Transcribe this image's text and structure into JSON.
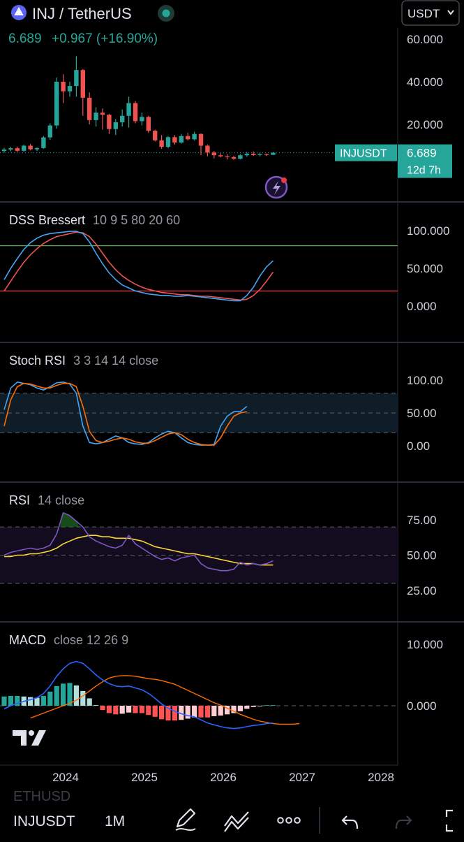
{
  "header": {
    "pair_title": "INJ / TetherUS",
    "price": "6.689",
    "change": "+0.967 (+16.90%)",
    "currency": "USDT"
  },
  "price_pane": {
    "axis_labels": [
      "60.000",
      "40.000",
      "20.000"
    ],
    "axis_values": [
      60,
      40,
      20
    ],
    "tag_symbol": "INJUSDT",
    "tag_price": "6.689",
    "tag_countdown": "12d 7h",
    "last_price": 6.689
  },
  "panes": {
    "dss": {
      "name": "DSS Bressert",
      "params": "10 9 5 80 20 60",
      "axis_labels": [
        "100.000",
        "50.000",
        "0.000"
      ]
    },
    "stoch": {
      "name": "Stoch RSI",
      "params": "3 3 14 14 close",
      "axis_labels": [
        "100.00",
        "50.00",
        "0.00"
      ]
    },
    "rsi": {
      "name": "RSI",
      "params": "14 close",
      "axis_labels": [
        "75.00",
        "50.00",
        "25.00"
      ]
    },
    "macd": {
      "name": "MACD",
      "params": "close 12 26 9",
      "axis_labels": [
        "10.000",
        "0.000"
      ]
    }
  },
  "time_axis": [
    "2024",
    "2025",
    "2026",
    "2027",
    "2028"
  ],
  "bottom_bar": {
    "watermark": "ETHUSD",
    "symbol": "INJUSDT",
    "interval": "1M"
  },
  "colors": {
    "background": "#000000",
    "up": "#26a69a",
    "down": "#ef5350",
    "blue": "#2962ff",
    "orange": "#ff6d00",
    "green_level": "#4caf50",
    "red_level": "#f23645",
    "rsi_line": "#7e57c2",
    "rsi_ma": "#fdd835"
  },
  "icons": [
    "brand-logo-icon",
    "market-open-icon",
    "chevron-down-icon",
    "lightning-icon",
    "tradingview-logo-icon",
    "pen-icon",
    "indicators-icon",
    "more-icon",
    "undo-icon",
    "redo-icon",
    "fullscreen-icon"
  ],
  "chart_data": {
    "type": "candlestick",
    "interval": "1M",
    "months": [
      "2023-04",
      "2023-05",
      "2023-06",
      "2023-07",
      "2023-08",
      "2023-09",
      "2023-10",
      "2023-11",
      "2023-12",
      "2024-01",
      "2024-02",
      "2024-03",
      "2024-04",
      "2024-05",
      "2024-06",
      "2024-07",
      "2024-08",
      "2024-09",
      "2024-10",
      "2024-11",
      "2024-12",
      "2025-01",
      "2025-02",
      "2025-03",
      "2025-04",
      "2025-05",
      "2025-06",
      "2025-07",
      "2025-08",
      "2025-09",
      "2025-10",
      "2025-11",
      "2025-12",
      "2026-01",
      "2026-02",
      "2026-03",
      "2026-04",
      "2026-05",
      "2026-06",
      "2026-07",
      "2026-08",
      "2026-09"
    ],
    "ohlc": [
      [
        7.5,
        9.0,
        6.8,
        8.2
      ],
      [
        8.2,
        9.5,
        7.4,
        8.8
      ],
      [
        8.8,
        9.6,
        7.0,
        7.6
      ],
      [
        7.6,
        10.5,
        7.2,
        10.0
      ],
      [
        10.0,
        10.8,
        7.8,
        8.3
      ],
      [
        8.3,
        9.2,
        7.5,
        8.9
      ],
      [
        8.9,
        14.5,
        8.5,
        13.9
      ],
      [
        13.9,
        20.5,
        12.8,
        19.5
      ],
      [
        19.5,
        42.0,
        18.0,
        40.0
      ],
      [
        40.0,
        43.5,
        30.0,
        35.5
      ],
      [
        35.5,
        40.0,
        33.0,
        38.0
      ],
      [
        38.0,
        52.0,
        33.0,
        45.5
      ],
      [
        45.5,
        46.0,
        24.0,
        32.5
      ],
      [
        32.5,
        35.0,
        20.0,
        22.0
      ],
      [
        22.0,
        28.0,
        19.0,
        25.5
      ],
      [
        25.5,
        27.5,
        17.5,
        24.5
      ],
      [
        24.5,
        25.0,
        15.5,
        17.8
      ],
      [
        17.8,
        22.5,
        15.0,
        21.0
      ],
      [
        21.0,
        27.0,
        19.0,
        24.0
      ],
      [
        24.0,
        33.0,
        18.5,
        30.0
      ],
      [
        30.0,
        31.0,
        20.5,
        21.5
      ],
      [
        21.5,
        25.5,
        19.5,
        23.5
      ],
      [
        23.5,
        24.0,
        16.0,
        17.0
      ],
      [
        17.0,
        17.5,
        12.0,
        12.5
      ],
      [
        12.5,
        15.0,
        8.5,
        9.5
      ],
      [
        9.5,
        14.5,
        8.8,
        14.0
      ],
      [
        14.0,
        15.0,
        10.5,
        11.5
      ],
      [
        11.5,
        15.5,
        11.0,
        14.5
      ],
      [
        14.5,
        16.0,
        12.5,
        13.0
      ],
      [
        13.0,
        16.5,
        12.5,
        15.5
      ],
      [
        15.5,
        15.8,
        5.5,
        10.0
      ],
      [
        10.0,
        10.5,
        5.0,
        6.8
      ],
      [
        6.8,
        7.5,
        4.0,
        5.5
      ],
      [
        5.5,
        6.5,
        4.5,
        5.0
      ],
      [
        5.0,
        6.0,
        3.5,
        4.6
      ],
      [
        4.6,
        5.2,
        3.4,
        3.9
      ],
      [
        3.9,
        6.0,
        3.6,
        5.5
      ],
      [
        5.5,
        7.0,
        4.8,
        6.2
      ],
      [
        6.2,
        7.3,
        5.2,
        5.6
      ],
      [
        5.6,
        6.8,
        5.0,
        6.0
      ],
      [
        6.0,
        6.4,
        5.2,
        5.722
      ],
      [
        5.722,
        7.0,
        5.6,
        6.689
      ]
    ],
    "price_axis": {
      "ticks": [
        60,
        40,
        20
      ],
      "last": 6.689
    },
    "dss": {
      "levels": [
        80,
        20
      ],
      "k": [
        35,
        50,
        63,
        75,
        84,
        90,
        94,
        96,
        97,
        98,
        99,
        99,
        96,
        85,
        70,
        56,
        44,
        35,
        28,
        24,
        20,
        18,
        16,
        15,
        14,
        14,
        13,
        13,
        14,
        13,
        12,
        11,
        10,
        9,
        8,
        7,
        7,
        14,
        25,
        40,
        52,
        60
      ],
      "d": [
        20,
        33,
        46,
        58,
        68,
        76,
        83,
        88,
        92,
        94,
        96,
        98,
        97,
        92,
        82,
        70,
        58,
        48,
        40,
        34,
        29,
        25,
        22,
        20,
        18,
        17,
        16,
        15,
        15,
        14,
        13,
        13,
        12,
        11,
        10,
        9,
        8,
        9,
        14,
        22,
        33,
        45
      ]
    },
    "stoch_rsi": {
      "levels": [
        80,
        50,
        20
      ],
      "k": [
        55,
        88,
        97,
        95,
        93,
        88,
        85,
        90,
        96,
        97,
        94,
        80,
        30,
        5,
        3,
        5,
        10,
        15,
        12,
        5,
        3,
        2,
        5,
        12,
        18,
        22,
        20,
        12,
        5,
        2,
        1,
        1,
        2,
        30,
        45,
        52,
        52,
        60
      ],
      "d": [
        30,
        70,
        90,
        95,
        94,
        91,
        88,
        88,
        92,
        95,
        95,
        90,
        60,
        22,
        8,
        5,
        7,
        10,
        12,
        10,
        6,
        4,
        4,
        8,
        13,
        18,
        20,
        17,
        10,
        5,
        2,
        1,
        1,
        12,
        30,
        45,
        50,
        52
      ]
    },
    "rsi": {
      "levels": [
        70,
        50,
        30
      ],
      "value": [
        50,
        52,
        53,
        54,
        55,
        54,
        55,
        57,
        65,
        80,
        78,
        74,
        70,
        63,
        60,
        58,
        56,
        55,
        57,
        64,
        58,
        55,
        52,
        49,
        47,
        48,
        46,
        48,
        49,
        50,
        44,
        41,
        40,
        39,
        39,
        40,
        45,
        43,
        44,
        43,
        44,
        46
      ],
      "ma": [
        49,
        49,
        50,
        50,
        51,
        51,
        52,
        53,
        55,
        58,
        60,
        62,
        63,
        64,
        64,
        63,
        63,
        62,
        62,
        62,
        61,
        60,
        58,
        56,
        55,
        54,
        53,
        52,
        51,
        51,
        50,
        49,
        48,
        47,
        46,
        45,
        44,
        44,
        44,
        43,
        43,
        43
      ]
    },
    "macd": {
      "macd": [
        -0.5,
        0.0,
        0.4,
        0.7,
        1.0,
        1.3,
        2.0,
        3.2,
        4.8,
        6.0,
        6.9,
        7.2,
        6.9,
        6.0,
        5.0,
        4.2,
        3.6,
        3.2,
        3.1,
        3.2,
        2.9,
        2.6,
        2.0,
        1.2,
        0.3,
        -0.4,
        -0.9,
        -1.3,
        -1.6,
        -1.8,
        -2.3,
        -2.8,
        -3.1,
        -3.4,
        -3.6,
        -3.7,
        -3.6,
        -3.4,
        -3.2,
        -3.1,
        -2.9,
        -2.8
      ],
      "signal": [
        -2.0,
        -1.6,
        -1.2,
        -0.8,
        -0.4,
        0.0,
        0.4,
        0.9,
        1.6,
        2.4,
        3.2,
        3.9,
        4.5,
        4.8,
        4.9,
        4.9,
        4.8,
        4.6,
        4.4,
        4.3,
        4.1,
        3.8,
        3.5,
        3.0,
        2.5,
        2.0,
        1.5,
        1.0,
        0.5,
        0.1,
        -0.4,
        -0.9,
        -1.4,
        -1.8,
        -2.2,
        -2.5,
        -2.7,
        -2.9,
        -3.0,
        -3.0,
        -3.0,
        -2.9
      ],
      "histogram": [
        1.5,
        1.6,
        1.6,
        1.5,
        1.4,
        1.3,
        1.6,
        2.3,
        3.2,
        3.6,
        3.7,
        3.3,
        2.4,
        1.2,
        0.1,
        -0.7,
        -1.2,
        -1.4,
        -1.3,
        -1.1,
        -1.2,
        -1.2,
        -1.5,
        -1.8,
        -2.2,
        -2.4,
        -2.4,
        -2.3,
        -2.1,
        -1.9,
        -1.9,
        -1.9,
        -1.7,
        -1.6,
        -1.4,
        -1.2,
        -0.9,
        -0.5,
        -0.2,
        -0.1,
        0.1,
        0.1
      ]
    }
  }
}
